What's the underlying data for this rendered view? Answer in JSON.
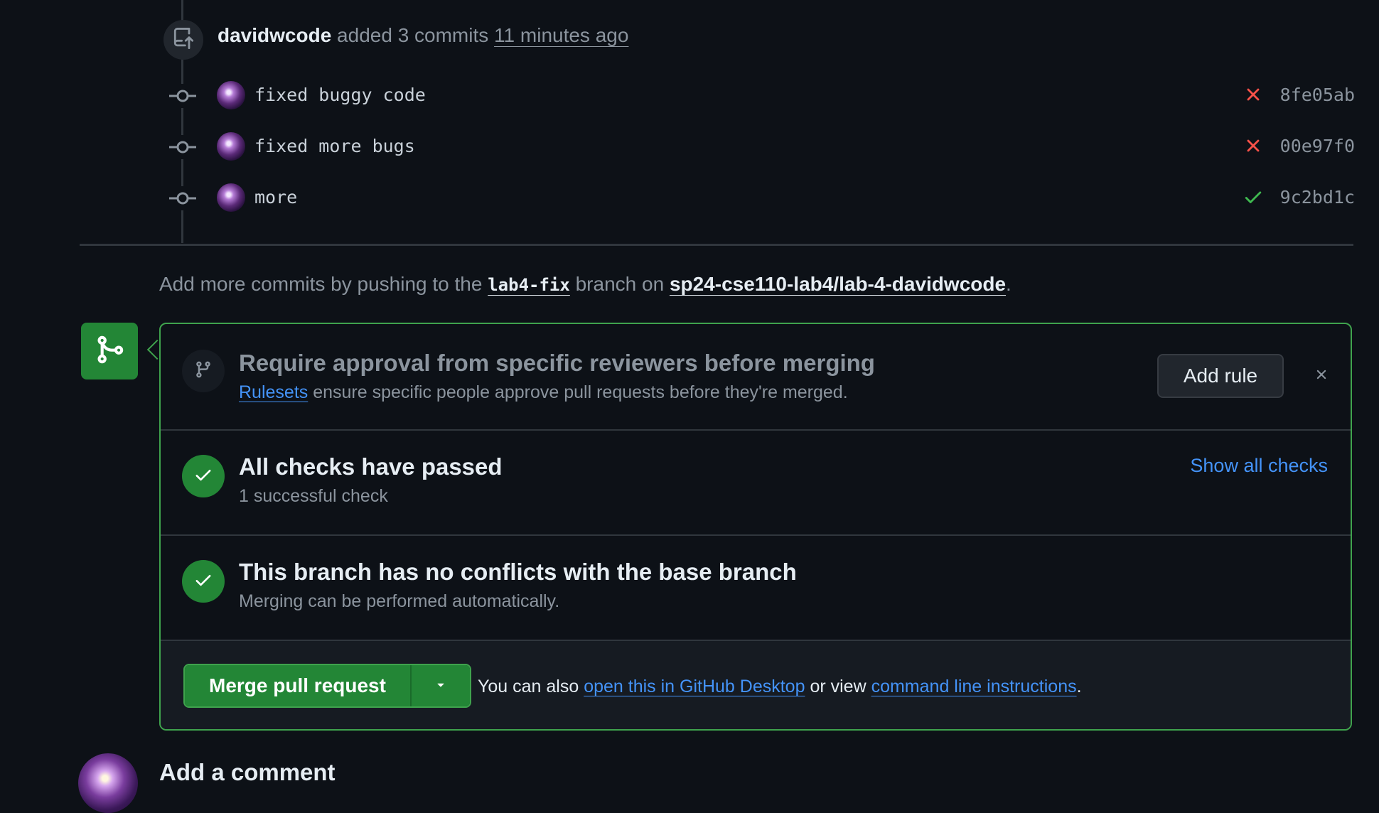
{
  "event": {
    "author": "davidwcode",
    "action": "added 3 commits",
    "time": "11 minutes ago"
  },
  "commits": [
    {
      "message": "fixed buggy code",
      "status": "failure",
      "sha": "8fe05ab"
    },
    {
      "message": "fixed more bugs",
      "status": "failure",
      "sha": "00e97f0"
    },
    {
      "message": "more",
      "status": "success",
      "sha": "9c2bd1c"
    }
  ],
  "push_hint": {
    "prefix": "Add more commits by pushing to the",
    "branch": "lab4-fix",
    "middle": "branch on",
    "repo": "sp24-cse110-lab4/lab-4-davidwcode",
    "suffix": "."
  },
  "rules_suggestion": {
    "title": "Require approval from specific reviewers before merging",
    "link_text": "Rulesets",
    "description": "ensure specific people approve pull requests before they're merged.",
    "button": "Add rule"
  },
  "checks": {
    "title": "All checks have passed",
    "subtitle": "1 successful check",
    "link": "Show all checks"
  },
  "conflicts": {
    "title": "This branch has no conflicts with the base branch",
    "subtitle": "Merging can be performed automatically."
  },
  "merge": {
    "button": "Merge pull request",
    "text_prefix": "You can also",
    "desktop_link": "open this in GitHub Desktop",
    "text_middle": "or view",
    "cli_link": "command line instructions",
    "text_suffix": "."
  },
  "comment": {
    "title": "Add a comment"
  },
  "colors": {
    "background": "#0d1117",
    "success": "#238636",
    "failure": "#f85149",
    "link": "#4493f8",
    "muted": "#8b949e"
  }
}
